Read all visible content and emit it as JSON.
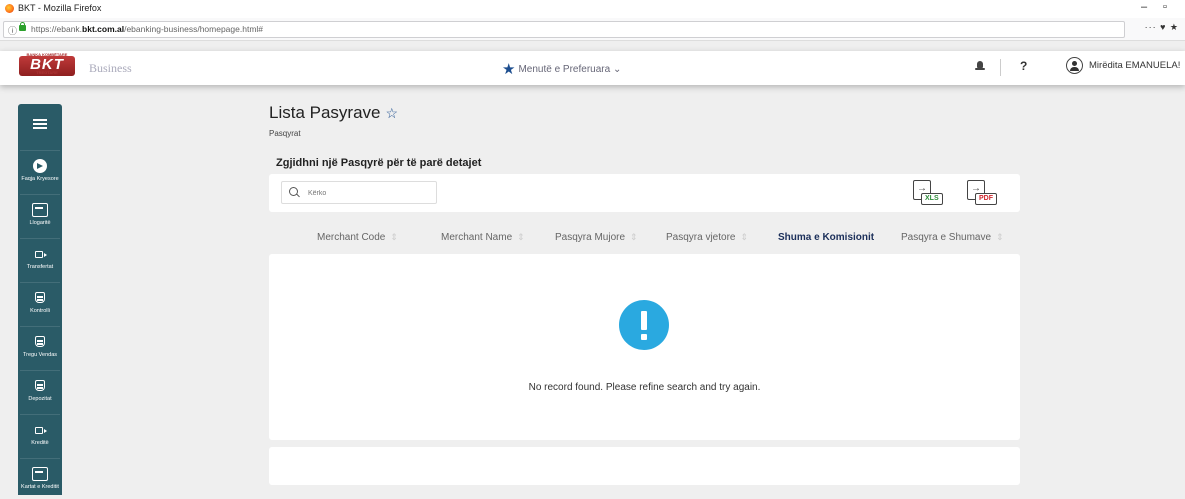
{
  "browser": {
    "window_title": "BKT - Mozilla Firefox",
    "url_prefix": "https://ebank.",
    "url_domain": "bkt.com.al",
    "url_path": "/ebanking-business/homepage.html#",
    "minimize": "–",
    "maximize": "▫",
    "menu_dots": "··· ♥ ★"
  },
  "header": {
    "logo_text": "BKT",
    "logo_sub": "BANKA KOMBËTARE TREGTARE",
    "business_label": "Business",
    "favorites_label": "Menutë e Preferuara",
    "favorites_chevron": "⌄",
    "help": "?",
    "user_greeting": "Mirëdita EMANUELA!",
    "user_chevron": "⌄"
  },
  "sidebar": {
    "items": [
      {
        "label": "Faqja Kryesore"
      },
      {
        "label": "Llogaritë"
      },
      {
        "label": "Transfertat"
      },
      {
        "label": "Kontrolli"
      },
      {
        "label": "Tregu Vendas"
      },
      {
        "label": "Depozitat"
      },
      {
        "label": "Kreditë"
      },
      {
        "label": "Kartat e Kreditit"
      }
    ]
  },
  "main": {
    "title": "Lista Pasyrave",
    "fav_star": "☆",
    "breadcrumb": "Pasqyrat",
    "subtitle": "Zgjidhni një Pasqyrë për të parë detajet",
    "search_placeholder": "Kërko",
    "export_xls": "XLS",
    "export_pdf": "PDF",
    "columns": [
      {
        "label": "Merchant Code",
        "sort": "⇕"
      },
      {
        "label": "Merchant Name",
        "sort": "⇕"
      },
      {
        "label": "Pasqyra Mujore",
        "sort": "⇕"
      },
      {
        "label": "Pasqyra vjetore",
        "sort": "⇕"
      },
      {
        "label": "Shuma e Komisionit",
        "sort": ""
      },
      {
        "label": "Pasqyra e Shumave",
        "sort": "⇕"
      }
    ],
    "empty_message": "No record found. Please refine search and try again."
  },
  "colors": {
    "sidebar": "#2a5b67",
    "accent_blue": "#1d4e8f",
    "alert": "#2aa9e0",
    "brand_red": "#c03a3a"
  }
}
